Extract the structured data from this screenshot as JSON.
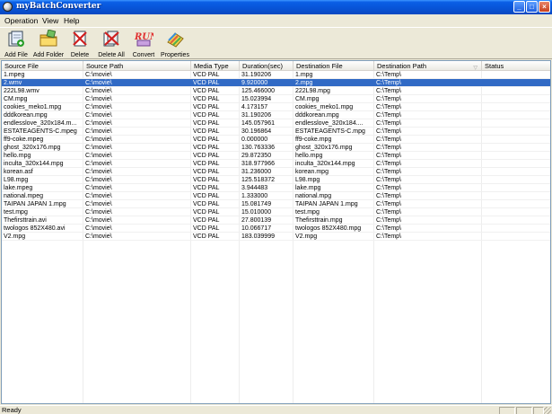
{
  "window": {
    "title": "myBatchConverter"
  },
  "menu": [
    {
      "label": "Operation"
    },
    {
      "label": "View"
    },
    {
      "label": "Help"
    }
  ],
  "toolbar": [
    {
      "label": "Add File",
      "icon": "add-file-icon"
    },
    {
      "label": "Add Folder",
      "icon": "add-folder-icon"
    },
    {
      "label": "Delete",
      "icon": "delete-icon"
    },
    {
      "label": "Delete All",
      "icon": "delete-all-icon"
    },
    {
      "label": "Convert",
      "icon": "convert-icon"
    },
    {
      "label": "Properties",
      "icon": "properties-icon"
    }
  ],
  "columns": [
    "Source File",
    "Source Path",
    "Media Type",
    "Duration(sec)",
    "Destination File",
    "Destination Path",
    "Status"
  ],
  "rows": [
    [
      "1.mpeg",
      "C:\\movie\\",
      "VCD PAL",
      "31.190206",
      "1.mpg",
      "C:\\Temp\\",
      ""
    ],
    [
      "2.wmv",
      "C:\\movie\\",
      "VCD PAL",
      "9.920000",
      "2.mpg",
      "C:\\Temp\\",
      ""
    ],
    [
      "222L98.wmv",
      "C:\\movie\\",
      "VCD PAL",
      "125.466000",
      "222L98.mpg",
      "C:\\Temp\\",
      ""
    ],
    [
      "CM.mpg",
      "C:\\movie\\",
      "VCD PAL",
      "15.023994",
      "CM.mpg",
      "C:\\Temp\\",
      ""
    ],
    [
      "cookies_meko1.mpg",
      "C:\\movie\\",
      "VCD PAL",
      "4.173157",
      "cookies_meko1.mpg",
      "C:\\Temp\\",
      ""
    ],
    [
      "dddkorean.mpg",
      "C:\\movie\\",
      "VCD PAL",
      "31.190206",
      "dddkorean.mpg",
      "C:\\Temp\\",
      ""
    ],
    [
      "endlesslove_320x184.m...",
      "C:\\movie\\",
      "VCD PAL",
      "145.057961",
      "endlesslove_320x184....",
      "C:\\Temp\\",
      ""
    ],
    [
      "ESTATEAGENTS-C.mpeg",
      "C:\\movie\\",
      "VCD PAL",
      "30.196864",
      "ESTATEAGENTS-C.mpg",
      "C:\\Temp\\",
      ""
    ],
    [
      "ff9-coke.mpeg",
      "C:\\movie\\",
      "VCD PAL",
      "0.000000",
      "ff9-coke.mpg",
      "C:\\Temp\\",
      ""
    ],
    [
      "ghost_320x176.mpg",
      "C:\\movie\\",
      "VCD PAL",
      "130.763336",
      "ghost_320x176.mpg",
      "C:\\Temp\\",
      ""
    ],
    [
      "hello.mpg",
      "C:\\movie\\",
      "VCD PAL",
      "29.872350",
      "hello.mpg",
      "C:\\Temp\\",
      ""
    ],
    [
      "inculta_320x144.mpg",
      "C:\\movie\\",
      "VCD PAL",
      "318.977966",
      "inculta_320x144.mpg",
      "C:\\Temp\\",
      ""
    ],
    [
      "korean.asf",
      "C:\\movie\\",
      "VCD PAL",
      "31.236000",
      "korean.mpg",
      "C:\\Temp\\",
      ""
    ],
    [
      "L98.mpg",
      "C:\\movie\\",
      "VCD PAL",
      "125.518372",
      "L98.mpg",
      "C:\\Temp\\",
      ""
    ],
    [
      "lake.mpeg",
      "C:\\movie\\",
      "VCD PAL",
      "3.944483",
      "lake.mpg",
      "C:\\Temp\\",
      ""
    ],
    [
      "national.mpeg",
      "C:\\movie\\",
      "VCD PAL",
      "1.333000",
      "national.mpg",
      "C:\\Temp\\",
      ""
    ],
    [
      "TAIPAN JAPAN 1.mpg",
      "C:\\movie\\",
      "VCD PAL",
      "15.081749",
      "TAIPAN JAPAN 1.mpg",
      "C:\\Temp\\",
      ""
    ],
    [
      "test.mpg",
      "C:\\movie\\",
      "VCD PAL",
      "15.010000",
      "test.mpg",
      "C:\\Temp\\",
      ""
    ],
    [
      "Thefirsttrain.avi",
      "C:\\movie\\",
      "VCD PAL",
      "27.800139",
      "Thefirsttrain.mpg",
      "C:\\Temp\\",
      ""
    ],
    [
      "twologos 852X480.avi",
      "C:\\movie\\",
      "VCD PAL",
      "10.066717",
      "twologos 852X480.mpg",
      "C:\\Temp\\",
      ""
    ],
    [
      "V2.mpg",
      "C:\\movie\\",
      "VCD PAL",
      "183.039999",
      "V2.mpg",
      "C:\\Temp\\",
      ""
    ]
  ],
  "selected_row": 1,
  "status": {
    "text": "Ready"
  },
  "colors": {
    "titlebar": "#0A5FE6",
    "selection": "#316AC5",
    "chrome": "#ECE9D8"
  }
}
